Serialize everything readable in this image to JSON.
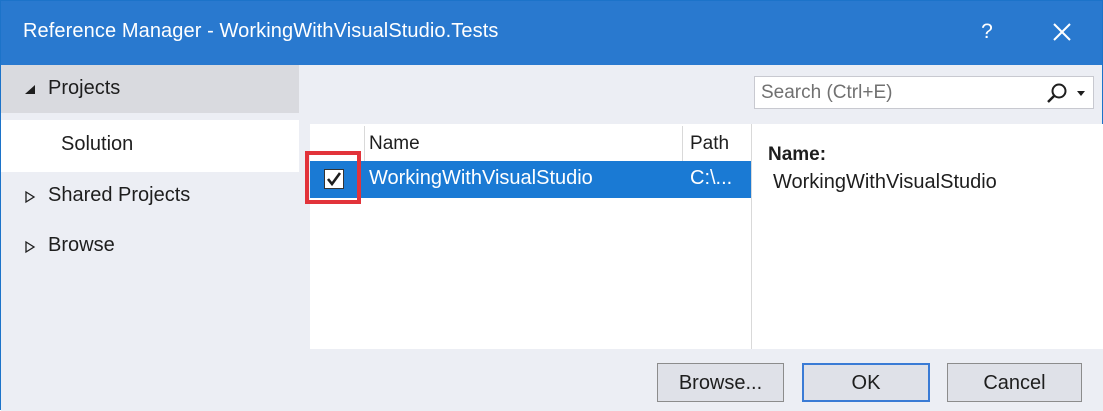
{
  "window": {
    "title": "Reference Manager - WorkingWithVisualStudio.Tests",
    "help_label": "?",
    "close_icon": "close-icon",
    "accent_color": "#2979cf"
  },
  "nav": {
    "items": [
      {
        "label": "Projects",
        "expanded": true,
        "icon": "triangle-down-icon"
      },
      {
        "label": "Solution",
        "selected": true
      },
      {
        "label": "Shared Projects",
        "expanded": false,
        "icon": "triangle-right-icon"
      },
      {
        "label": "Browse",
        "expanded": false,
        "icon": "triangle-right-icon"
      }
    ]
  },
  "search": {
    "placeholder": "Search (Ctrl+E)",
    "value": ""
  },
  "list": {
    "columns": [
      "Name",
      "Path"
    ],
    "rows": [
      {
        "checked": true,
        "name": "WorkingWithVisualStudio",
        "path": "C:\\..."
      }
    ],
    "selection_color": "#1a7ad4"
  },
  "details": {
    "label": "Name:",
    "value": "WorkingWithVisualStudio"
  },
  "buttons": {
    "browse": "Browse...",
    "ok": "OK",
    "cancel": "Cancel"
  },
  "annotation_color": "#e2333a"
}
